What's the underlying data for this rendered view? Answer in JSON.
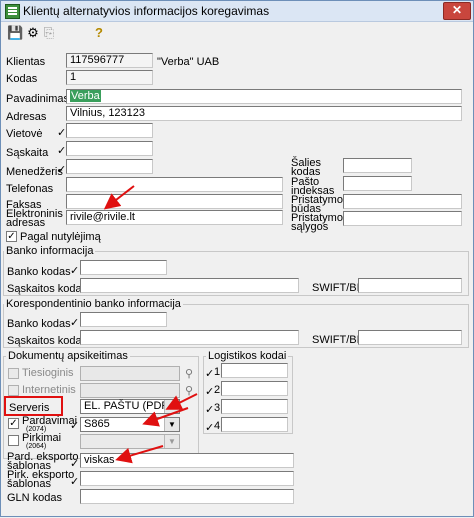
{
  "window": {
    "title": "Klientų alternatyvios informacijos koregavimas",
    "close": "✕"
  },
  "toolbar": {
    "save": "💾",
    "tool2": "⚙",
    "tool3": "⎘",
    "help": "?"
  },
  "fields": {
    "klientas_label": "Klientas",
    "klientas_code": "117596777",
    "klientas_name": "\"Verba\" UAB",
    "kodas_label": "Kodas",
    "kodas_value": "1",
    "pavadinimas_label": "Pavadinimas",
    "pavadinimas_value": "Verba",
    "adresas_label": "Adresas",
    "adresas_value": "Vilnius, 123123",
    "vietove_label": "Vietovė",
    "saskaita_label": "Sąskaita",
    "menedzeris_label": "Menedžeris",
    "telefonas_label": "Telefonas",
    "faksas_label": "Faksas",
    "email_label_1": "Elektroninis",
    "email_label_2": "adresas",
    "email_value": "rivile@rivile.lt",
    "salies_kodas_1": "Šalies",
    "salies_kodas_2": "kodas",
    "pasto_indeksas_1": "Pašto",
    "pasto_indeksas_2": "indeksas",
    "pristatymo_budas_1": "Pristatymo",
    "pristatymo_budas_2": "būdas",
    "pristatymo_salygos_1": "Pristatymo",
    "pristatymo_salygos_2": "sąlygos",
    "pagal_nutylejima": "Pagal nutylėjimą"
  },
  "bank": {
    "title": "Banko informacija",
    "banko_kodas": "Banko kodas",
    "saskaitos_kodas": "Sąskaitos kodas",
    "swift": "SWIFT/BIC"
  },
  "corr_bank": {
    "title": "Korespondentinio banko informacija",
    "banko_kodas": "Banko kodas",
    "saskaitos_kodas": "Sąskaitos kodas",
    "swift": "SWIFT/BIC"
  },
  "docs": {
    "title": "Dokumentų apsikeitimas",
    "tiesioginis": "Tiesioginis",
    "internetinis": "Internetinis",
    "serveris": "Serveris",
    "serveris_value": "EL. PAŠTU (PDF)",
    "pardavimai": "Pardavimai",
    "pardavimai_sub": "(2074)",
    "pardavimai_value": "S865",
    "pirkimai": "Pirkimai",
    "pirkimai_sub": "(2064)",
    "pard_eksp_1": "Pard. eksporto",
    "pard_eksp_2": "šablonas",
    "pard_eksp_value": "viskas",
    "pirk_eksp_1": "Pirk. eksporto",
    "pirk_eksp_2": "šablonas",
    "gln": "GLN kodas"
  },
  "logistics": {
    "title": "Logistikos kodai",
    "codes": [
      "1",
      "2",
      "3",
      "4"
    ]
  },
  "check_mark": "✓",
  "accent": {
    "highlight": "#3a9f5c",
    "annotation": "#e01010"
  }
}
